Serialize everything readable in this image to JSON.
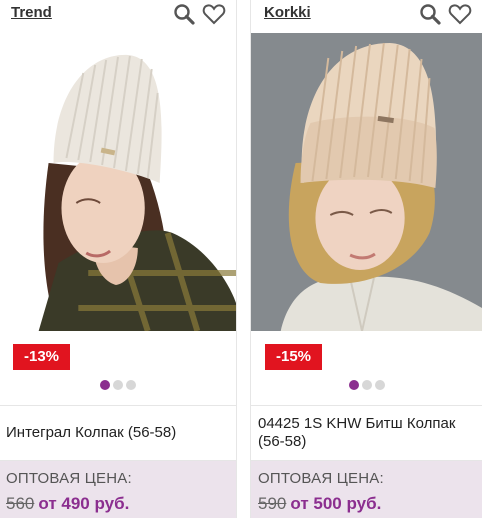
{
  "products": [
    {
      "brand": "Trend",
      "discount": "-13%",
      "name": "Интеграл Колпак (56-58)",
      "price_label": "ОПТОВАЯ ЦЕНА:",
      "old_price": "560",
      "new_price": "от 490 руб.",
      "slide_count": 3,
      "active_slide": 1
    },
    {
      "brand": "Korkki",
      "discount": "-15%",
      "name": "04425 1S KHW Битш Колпак (56-58)",
      "price_label": "ОПТОВАЯ ЦЕНА:",
      "old_price": "590",
      "new_price": "от 500 руб.",
      "slide_count": 3,
      "active_slide": 1
    }
  ],
  "icons": {
    "search": "search-icon",
    "favorite": "heart-icon"
  },
  "colors": {
    "discount_badge": "#e1141f",
    "accent": "#8b2e8f",
    "price_bg": "#ece3ec"
  }
}
